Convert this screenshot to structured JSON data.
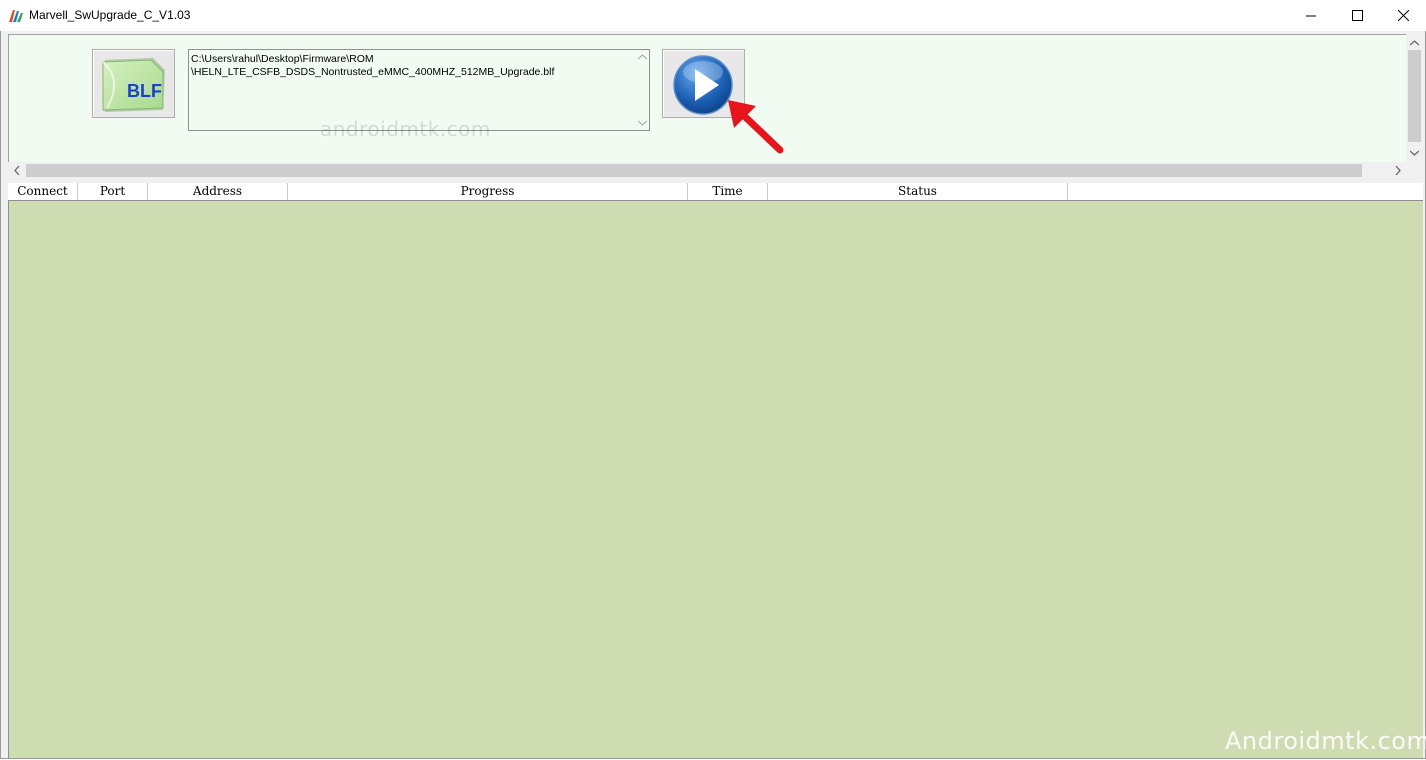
{
  "window": {
    "title": "Marvell_SwUpgrade_C_V1.03"
  },
  "controls": {
    "blf_button_label": "BLF",
    "path_value": "C:\\Users\\rahul\\Desktop\\Firmware\\ROM\n\\HELN_LTE_CSFB_DSDS_Nontrusted_eMMC_400MHZ_512MB_Upgrade.blf",
    "start_button_icon": "play-icon"
  },
  "table": {
    "columns": [
      "Connect",
      "Port",
      "Address",
      "Progress",
      "Time",
      "Status"
    ],
    "rows": []
  },
  "watermark": {
    "top": "androidmtk.com",
    "bottom": "Androidmtk.com"
  },
  "colors": {
    "top_panel_bg": "#f1fbf1",
    "list_bg": "#cfdbb1",
    "play_button_blue": "#1a5fb4",
    "annotation_arrow": "#e8141c"
  }
}
